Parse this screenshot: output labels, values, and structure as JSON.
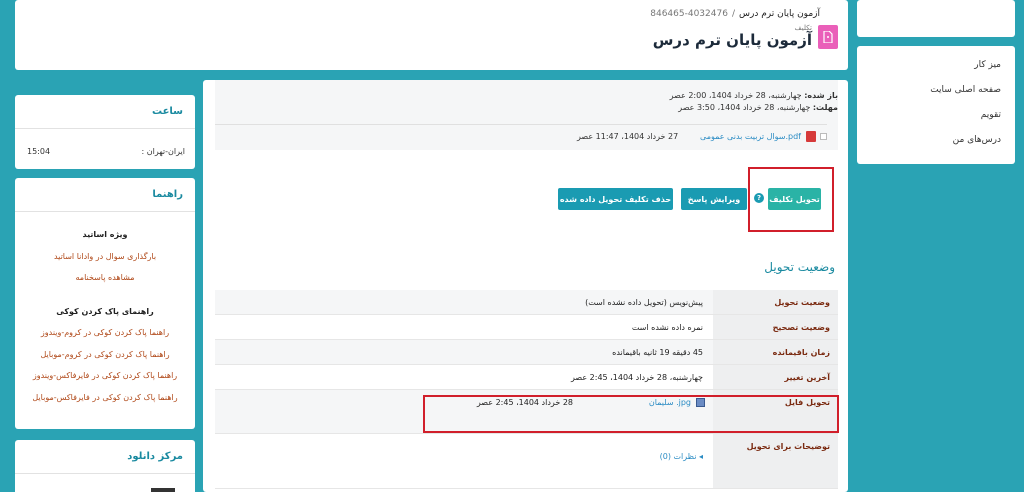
{
  "header": {
    "breadcrumb_id": "4032476-846465",
    "breadcrumb_sep": "/",
    "breadcrumb_title": "آزمون پایان ترم درس",
    "title_small": "تکلیف",
    "title": "آزمون پایان ترم درس"
  },
  "nav": {
    "items": [
      "میز کار",
      "صفحه اصلی سایت",
      "تقویم",
      "درس‌های من"
    ]
  },
  "dates": {
    "opened_label": "باز شده:",
    "opened_value": "چهارشنبه، 28 خرداد 1404، 2:00 عصر",
    "due_label": "مهلت:",
    "due_value": "چهارشنبه، 28 خرداد 1404، 3:50 عصر"
  },
  "attachment": {
    "name": "سوال تربیت بدنی عمومی.pdf",
    "date": "27 خرداد 1404، 11:47 عصر"
  },
  "buttons": {
    "submit": "تحویل تکلیف",
    "edit": "ویرایش پاسخ",
    "delete": "حذف تکلیف تحویل داده شده",
    "help": "?"
  },
  "status": {
    "title": "وضعیت تحویل",
    "rows": [
      {
        "label": "وضعیت تحویل",
        "value": "پیش‌نویس (تحویل داده نشده است)"
      },
      {
        "label": "وضعیت تصحیح",
        "value": "نمره داده نشده است"
      },
      {
        "label": "زمان باقیمانده",
        "value": "45 دقیقه 19 ثانیه باقیمانده"
      },
      {
        "label": "آخرین تغییر",
        "value": "چهارشنبه، 28 خرداد 1404، 2:45 عصر"
      },
      {
        "label": "تحویل فایل",
        "value": ""
      },
      {
        "label": "توضیحات برای تحویل",
        "value": ""
      }
    ],
    "file_name": "سلیمان .jpg",
    "file_date": "28 خرداد 1404، 2:45 عصر",
    "comments": "◂ نظرات (0)"
  },
  "clock": {
    "title": "ساعت",
    "location": "ایران-تهران :",
    "time": "15:04"
  },
  "guide": {
    "title": "راهنما",
    "section1": "ویژه اساتید",
    "link1": "بارگذاری سوال در وادانا اساتید",
    "link2": "مشاهده پاسخنامه",
    "section2": "راهنمای پاک کردن کوکی",
    "link3": "راهنما پاک کردن کوکی در کروم-ویندوز",
    "link4": "راهنما پاک کردن کوکی در کروم-موبایل",
    "link5": "راهنما پاک کردن کوکی در فایرفاکس-ویندوز",
    "link6": "راهنما پاک کردن کوکی در فایرفاکس-موبایل"
  },
  "download": {
    "title": "مرکز دانلود"
  }
}
